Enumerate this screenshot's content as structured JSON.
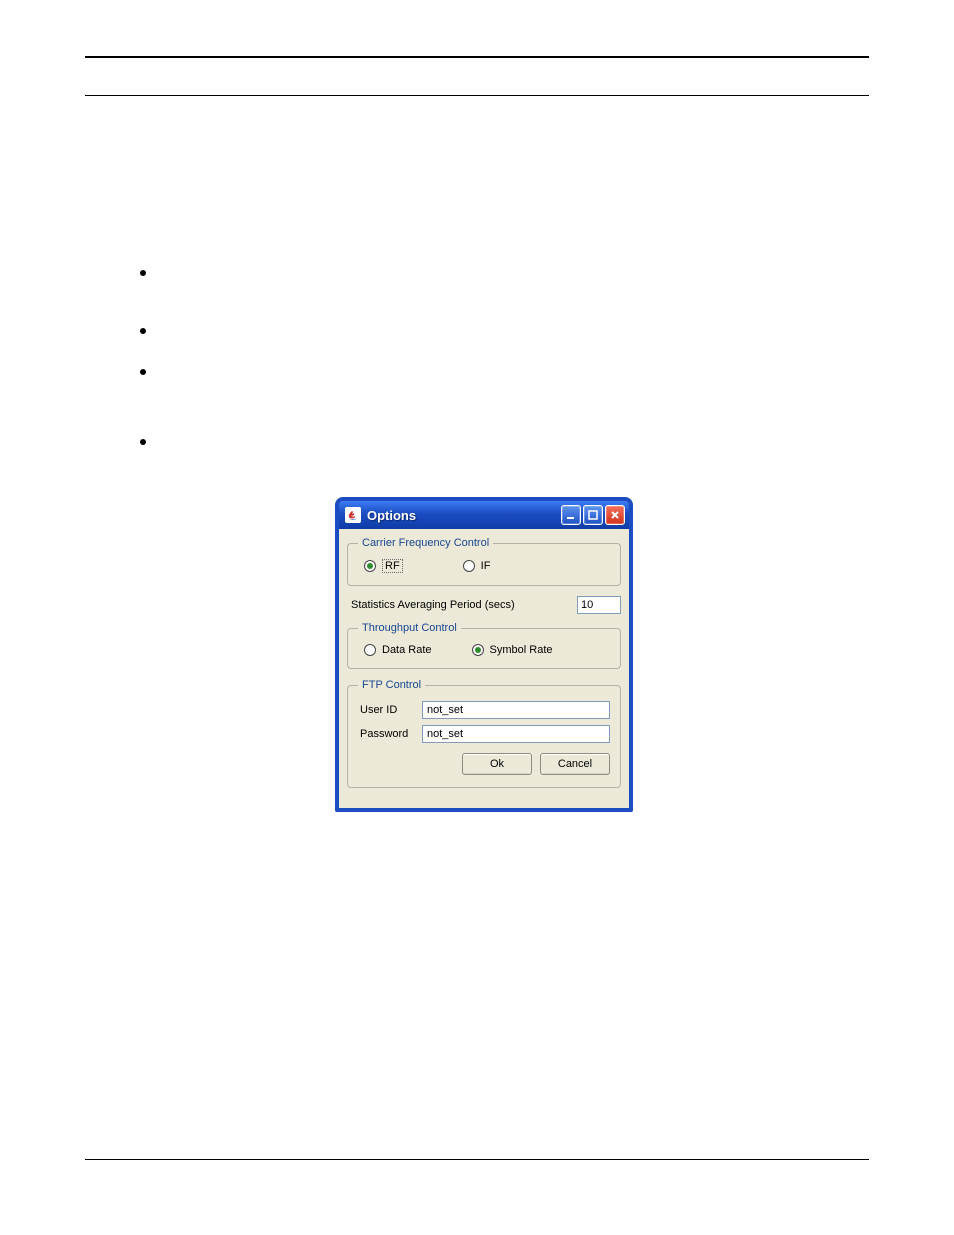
{
  "dialog": {
    "title": "Options",
    "carrier": {
      "legend": "Carrier Frequency Control",
      "rf_label": "RF",
      "if_label": "IF",
      "selected": "RF"
    },
    "stats": {
      "label": "Statistics Averaging Period (secs)",
      "value": "10"
    },
    "throughput": {
      "legend": "Throughput Control",
      "data_rate_label": "Data Rate",
      "symbol_rate_label": "Symbol Rate",
      "selected": "Symbol Rate"
    },
    "ftp": {
      "legend": "FTP Control",
      "user_label": "User ID",
      "user_value": "not_set",
      "password_label": "Password",
      "password_value": "not_set"
    },
    "buttons": {
      "ok": "Ok",
      "cancel": "Cancel"
    }
  }
}
